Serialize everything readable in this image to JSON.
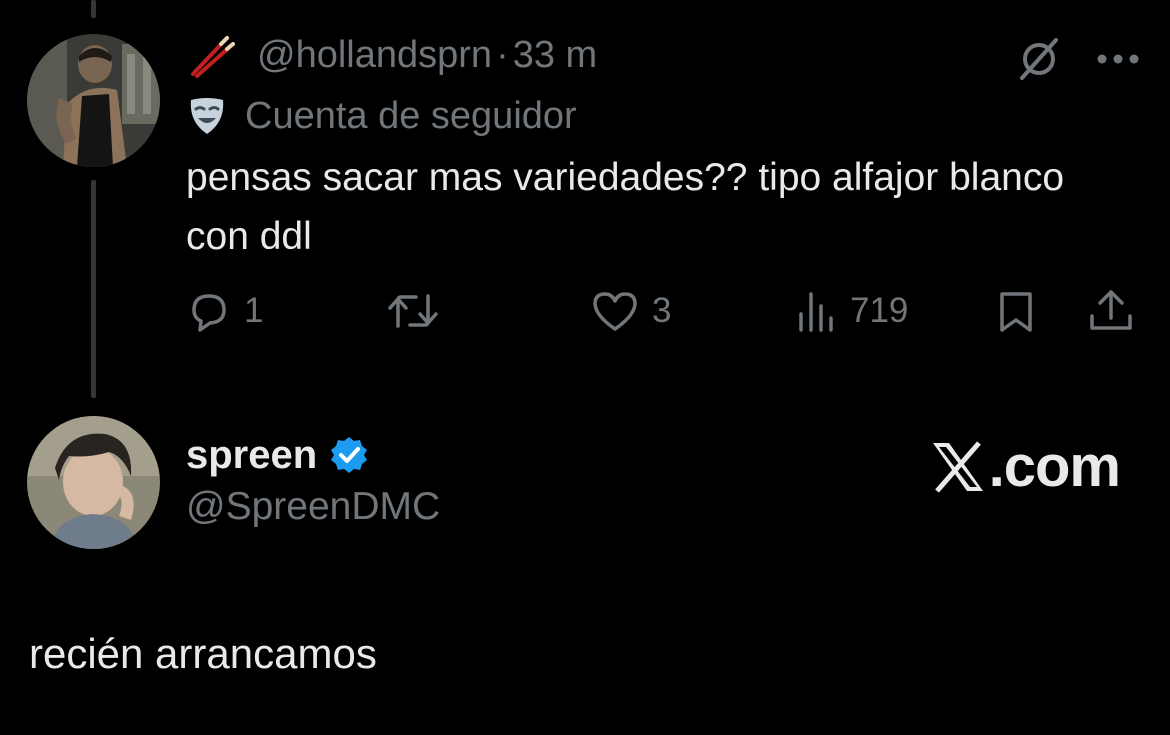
{
  "reply": {
    "emoji": "chopsticks-icon",
    "handle": "@hollandsprn",
    "separator": "·",
    "time": "33 m",
    "account_type": "Cuenta de seguidor",
    "text": "pensas sacar mas variedades?? tipo alfajor blanco con ddl",
    "actions": {
      "replies": "1",
      "retweets": "",
      "likes": "3",
      "views": "719"
    }
  },
  "main": {
    "author_name": "spreen",
    "author_handle": "@SpreenDMC",
    "verified": true,
    "watermark": ".com",
    "text": "recién arrancamos"
  },
  "colors": {
    "background": "#000000",
    "text": "#e7e9ea",
    "muted": "#71767b",
    "verified": "#1d9bf0",
    "thread_line": "#333639"
  }
}
